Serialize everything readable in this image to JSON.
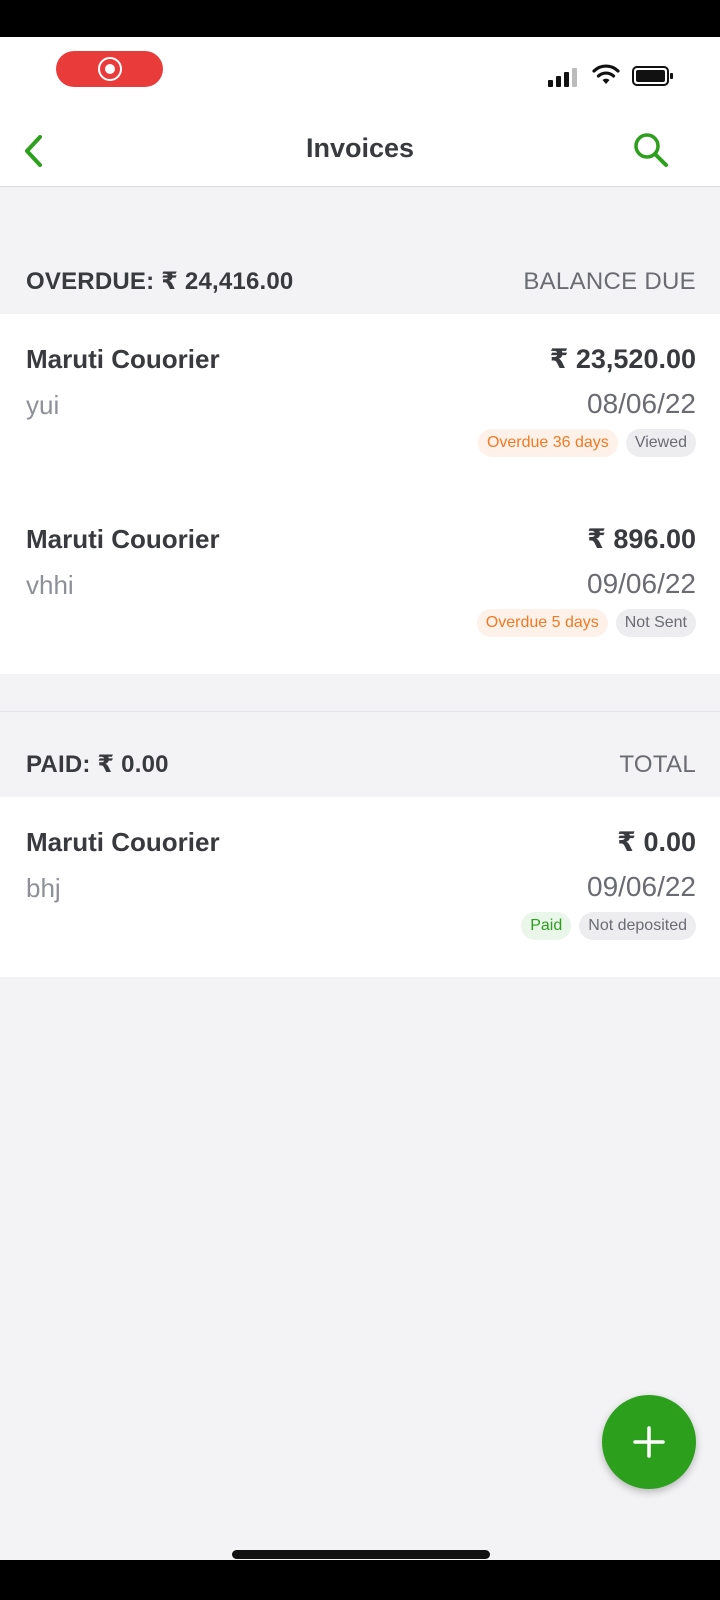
{
  "status_bar": {
    "record_icon": "screen-record-icon",
    "signal_icon": "cellular-signal-icon",
    "wifi_icon": "wifi-icon",
    "battery_icon": "battery-icon"
  },
  "nav": {
    "title": "Invoices",
    "back_icon": "chevron-left-icon",
    "search_icon": "search-icon",
    "accent_color": "#2ca01c"
  },
  "overdue_section": {
    "label": "OVERDUE: ₹ 24,416.00",
    "column_label": "BALANCE DUE",
    "invoices": [
      {
        "customer": "Maruti Couorier",
        "memo": "yui",
        "amount": "₹ 23,520.00",
        "date": "08/06/22",
        "status": "Overdue 36 days",
        "delivery": "Viewed"
      },
      {
        "customer": "Maruti Couorier",
        "memo": "vhhi",
        "amount": "₹ 896.00",
        "date": "09/06/22",
        "status": "Overdue 5 days",
        "delivery": "Not Sent"
      }
    ]
  },
  "paid_section": {
    "label": "PAID: ₹ 0.00",
    "column_label": "TOTAL",
    "invoices": [
      {
        "customer": "Maruti Couorier",
        "memo": "bhj",
        "amount": "₹ 0.00",
        "date": "09/06/22",
        "status": "Paid",
        "delivery": "Not deposited"
      }
    ]
  },
  "fab": {
    "icon": "plus-icon"
  },
  "colors": {
    "overdue": "#f07a22",
    "paid": "#2ca01c",
    "background": "#f3f3f6"
  }
}
